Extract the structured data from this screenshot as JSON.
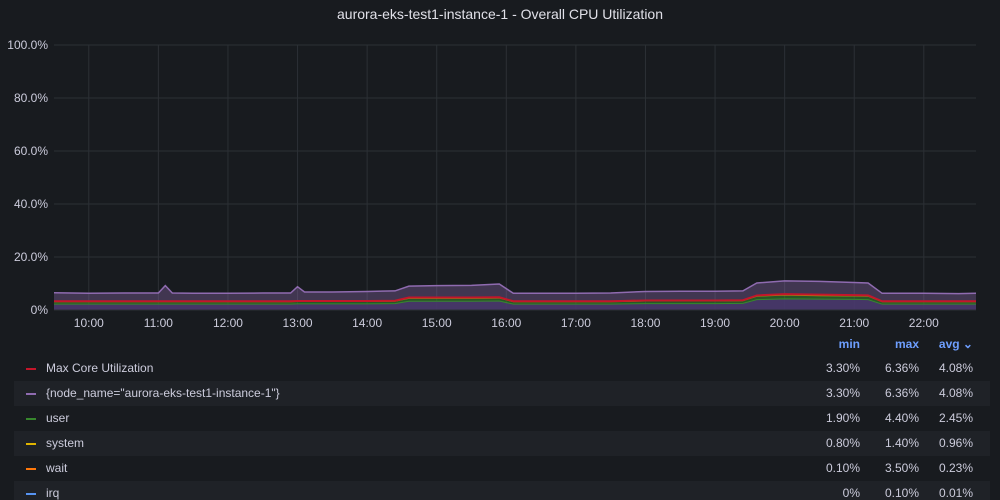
{
  "panel": {
    "title": "aurora-eks-test1-instance-1 - Overall CPU Utilization"
  },
  "chart_data": {
    "type": "area",
    "title": "aurora-eks-test1-instance-1 - Overall CPU Utilization",
    "ylim": [
      0,
      100
    ],
    "y_ticks": [
      "0%",
      "20.0%",
      "40.0%",
      "60.0%",
      "80.0%",
      "100.0%"
    ],
    "y_tick_values": [
      0,
      20,
      40,
      60,
      80,
      100
    ],
    "x_ticks": [
      "10:00",
      "11:00",
      "12:00",
      "13:00",
      "14:00",
      "15:00",
      "16:00",
      "17:00",
      "18:00",
      "19:00",
      "20:00",
      "21:00",
      "22:00"
    ],
    "x_tick_hours": [
      10,
      11,
      12,
      13,
      14,
      15,
      16,
      17,
      18,
      19,
      20,
      21,
      22
    ],
    "xlim_hours": [
      9.5,
      22.75
    ],
    "grid": true,
    "time_hours": [
      9.5,
      10.0,
      10.5,
      11.0,
      11.1,
      11.2,
      11.5,
      12.0,
      12.5,
      12.9,
      13.0,
      13.1,
      13.5,
      14.0,
      14.4,
      14.6,
      15.0,
      15.5,
      15.9,
      16.1,
      16.5,
      17.0,
      17.5,
      18.0,
      18.5,
      19.0,
      19.4,
      19.6,
      20.0,
      20.5,
      21.0,
      21.2,
      21.4,
      21.5,
      22.0,
      22.5,
      22.75
    ],
    "series": [
      {
        "name": "user",
        "color": "#37872d",
        "values": [
          2.2,
          2.2,
          2.2,
          2.2,
          2.2,
          2.2,
          2.2,
          2.2,
          2.2,
          2.2,
          2.3,
          2.3,
          2.3,
          2.3,
          2.4,
          3.3,
          3.3,
          3.3,
          3.4,
          2.2,
          2.2,
          2.2,
          2.2,
          2.4,
          2.4,
          2.4,
          2.5,
          3.9,
          4.2,
          4.1,
          4.0,
          3.9,
          2.2,
          2.2,
          2.2,
          2.2,
          2.2
        ]
      },
      {
        "name": "system",
        "color": "#e0b400",
        "values": [
          0.9,
          0.9,
          0.9,
          0.9,
          0.9,
          0.9,
          0.9,
          0.9,
          0.9,
          0.9,
          0.9,
          0.9,
          0.9,
          0.9,
          0.9,
          1.1,
          1.1,
          1.1,
          1.1,
          0.9,
          0.9,
          0.9,
          0.9,
          1.0,
          1.0,
          1.0,
          1.0,
          1.3,
          1.4,
          1.3,
          1.3,
          1.3,
          0.9,
          0.9,
          0.9,
          0.9,
          0.9
        ]
      },
      {
        "name": "wait",
        "color": "#ff780a",
        "values": [
          0.2,
          0.2,
          0.2,
          0.2,
          0.2,
          0.2,
          0.2,
          0.2,
          0.2,
          0.2,
          0.2,
          0.2,
          0.2,
          0.2,
          0.2,
          0.3,
          0.3,
          0.3,
          0.3,
          0.2,
          0.2,
          0.2,
          0.2,
          0.2,
          0.2,
          0.2,
          0.2,
          0.3,
          0.3,
          0.3,
          0.3,
          0.3,
          0.2,
          0.2,
          0.2,
          0.2,
          0.2
        ]
      },
      {
        "name": "Max Core Utilization",
        "color": "#c4162a",
        "values": [
          3.3,
          3.3,
          3.3,
          3.3,
          3.3,
          3.3,
          3.3,
          3.3,
          3.3,
          3.3,
          3.4,
          3.4,
          3.4,
          3.4,
          3.5,
          4.7,
          4.7,
          4.7,
          4.8,
          3.3,
          3.3,
          3.3,
          3.3,
          3.6,
          3.6,
          3.6,
          3.7,
          5.5,
          6.0,
          5.8,
          5.6,
          5.5,
          3.3,
          3.3,
          3.3,
          3.3,
          3.3
        ]
      },
      {
        "name": "{node_name=\"aurora-eks-test1-instance-1\"}",
        "color": "#8f6bb0",
        "values": [
          6.5,
          6.3,
          6.4,
          6.4,
          9.2,
          6.4,
          6.3,
          6.3,
          6.4,
          6.4,
          8.8,
          6.8,
          6.8,
          7.0,
          7.2,
          9.0,
          9.2,
          9.3,
          9.8,
          6.3,
          6.3,
          6.3,
          6.4,
          7.0,
          7.1,
          7.1,
          7.2,
          10.2,
          11.0,
          10.8,
          10.4,
          10.2,
          6.3,
          6.3,
          6.3,
          6.2,
          6.3
        ]
      }
    ]
  },
  "legend": {
    "headers": {
      "min": "min",
      "max": "max",
      "avg": "avg ⌄"
    },
    "rows": [
      {
        "name": "Max Core Utilization",
        "color": "#c4162a",
        "min": "3.30%",
        "max": "6.36%",
        "avg": "4.08%"
      },
      {
        "name": "{node_name=\"aurora-eks-test1-instance-1\"}",
        "color": "#8f6bb0",
        "min": "3.30%",
        "max": "6.36%",
        "avg": "4.08%"
      },
      {
        "name": "user",
        "color": "#37872d",
        "min": "1.90%",
        "max": "4.40%",
        "avg": "2.45%"
      },
      {
        "name": "system",
        "color": "#e0b400",
        "min": "0.80%",
        "max": "1.40%",
        "avg": "0.96%"
      },
      {
        "name": "wait",
        "color": "#ff780a",
        "min": "0.10%",
        "max": "3.50%",
        "avg": "0.23%"
      },
      {
        "name": "irq",
        "color": "#5794f2",
        "min": "0%",
        "max": "0.10%",
        "avg": "0.01%"
      }
    ]
  }
}
